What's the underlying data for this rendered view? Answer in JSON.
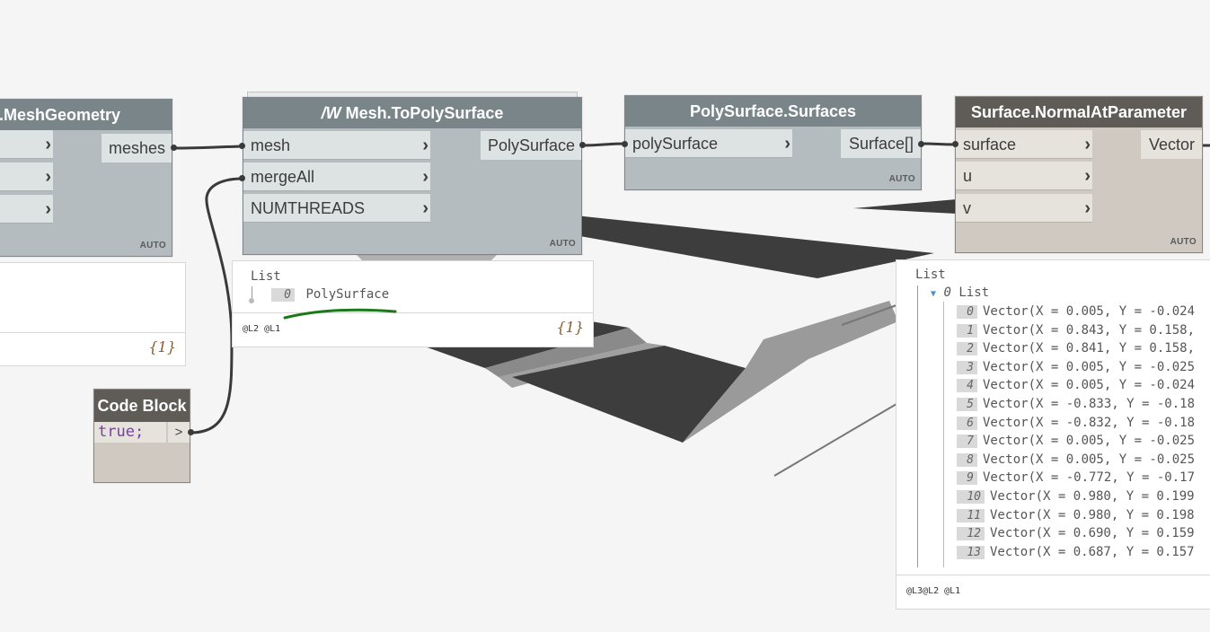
{
  "nodes": {
    "mesh_geometry": {
      "title": ".MeshGeometry",
      "output": "meshes",
      "auto": "AUTO",
      "count": "{1}"
    },
    "to_polysurface": {
      "title": "Mesh.ToPolySurface",
      "inputs": [
        "mesh",
        "mergeAll",
        "NUMTHREADS"
      ],
      "output": "PolySurface",
      "auto": "AUTO"
    },
    "polysurface_surfaces": {
      "title": "PolySurface.Surfaces",
      "input": "polySurface",
      "output": "Surface[]",
      "auto": "AUTO"
    },
    "normal_at_param": {
      "title": "Surface.NormalAtParameter",
      "inputs": [
        "surface",
        "u",
        "v"
      ],
      "output": "Vector",
      "auto": "AUTO"
    },
    "code_block": {
      "title": "Code Block",
      "code": "true;",
      "output_glyph": ">"
    }
  },
  "preview_polysurface": {
    "header": "List",
    "item_index": "0",
    "item_value": "PolySurface",
    "levels": "@L2 @L1",
    "count": "{1}"
  },
  "preview_vectors": {
    "header": "List",
    "sublist_index": "0",
    "sublist_label": "List",
    "levels": "@L3@L2 @L1",
    "items": [
      {
        "i": "0",
        "v": "Vector(X = 0.005, Y = -0.024"
      },
      {
        "i": "1",
        "v": "Vector(X = 0.843, Y = 0.158,"
      },
      {
        "i": "2",
        "v": "Vector(X = 0.841, Y = 0.158,"
      },
      {
        "i": "3",
        "v": "Vector(X = 0.005, Y = -0.025"
      },
      {
        "i": "4",
        "v": "Vector(X = 0.005, Y = -0.024"
      },
      {
        "i": "5",
        "v": "Vector(X = -0.833, Y = -0.18"
      },
      {
        "i": "6",
        "v": "Vector(X = -0.832, Y = -0.18"
      },
      {
        "i": "7",
        "v": "Vector(X = 0.005, Y = -0.025"
      },
      {
        "i": "8",
        "v": "Vector(X = 0.005, Y = -0.025"
      },
      {
        "i": "9",
        "v": "Vector(X = -0.772, Y = -0.17"
      },
      {
        "i": "10",
        "v": "Vector(X = 0.980, Y = 0.199"
      },
      {
        "i": "11",
        "v": "Vector(X = 0.980, Y = 0.198"
      },
      {
        "i": "12",
        "v": "Vector(X = 0.690, Y = 0.159"
      },
      {
        "i": "13",
        "v": "Vector(X = 0.687, Y = 0.157"
      }
    ]
  },
  "colors": {
    "canvas": "#f5f5f5",
    "node_header_grey": "#7a858a",
    "node_header_dark": "#5f5c58",
    "wire": "#3a3a3a",
    "annotation_stroke": "#1a7a1a"
  }
}
